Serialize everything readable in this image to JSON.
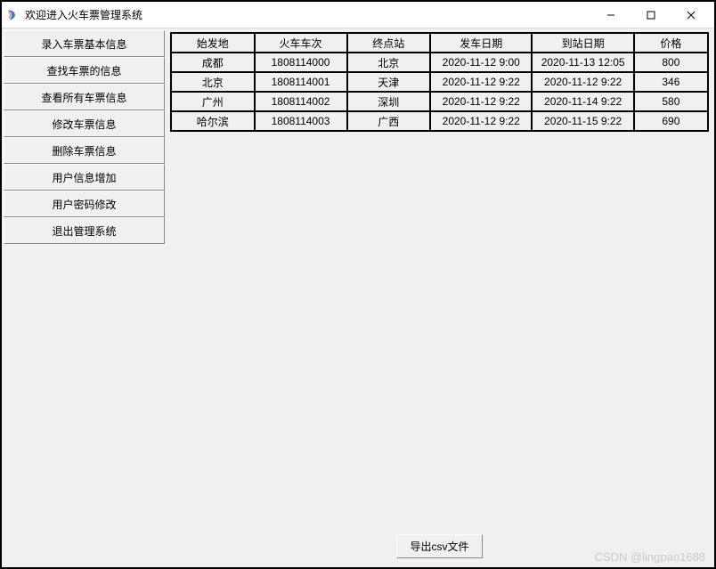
{
  "window": {
    "title": "欢迎进入火车票管理系统"
  },
  "sidebar": {
    "items": [
      {
        "label": "录入车票基本信息"
      },
      {
        "label": "查找车票的信息"
      },
      {
        "label": "查看所有车票信息"
      },
      {
        "label": "修改车票信息"
      },
      {
        "label": "删除车票信息"
      },
      {
        "label": "用户信息增加"
      },
      {
        "label": "用户密码修改"
      },
      {
        "label": "退出管理系统"
      }
    ]
  },
  "table": {
    "headers": {
      "origin": "始发地",
      "train_no": "火车车次",
      "destination": "终点站",
      "depart_date": "发车日期",
      "arrive_date": "到站日期",
      "price": "价格"
    },
    "rows": [
      {
        "origin": "成都",
        "train_no": "1808114000",
        "destination": "北京",
        "depart_date": "2020-11-12 9:00",
        "arrive_date": "2020-11-13 12:05",
        "price": "800"
      },
      {
        "origin": "北京",
        "train_no": "1808114001",
        "destination": "天津",
        "depart_date": "2020-11-12 9:22",
        "arrive_date": "2020-11-12 9:22",
        "price": "346"
      },
      {
        "origin": "广州",
        "train_no": "1808114002",
        "destination": "深圳",
        "depart_date": "2020-11-12 9:22",
        "arrive_date": "2020-11-14 9:22",
        "price": "580"
      },
      {
        "origin": "哈尔滨",
        "train_no": "1808114003",
        "destination": "广西",
        "depart_date": "2020-11-12 9:22",
        "arrive_date": "2020-11-15 9:22",
        "price": "690"
      }
    ]
  },
  "export_button": "导出csv文件",
  "watermark": "CSDN @lingpao1688"
}
